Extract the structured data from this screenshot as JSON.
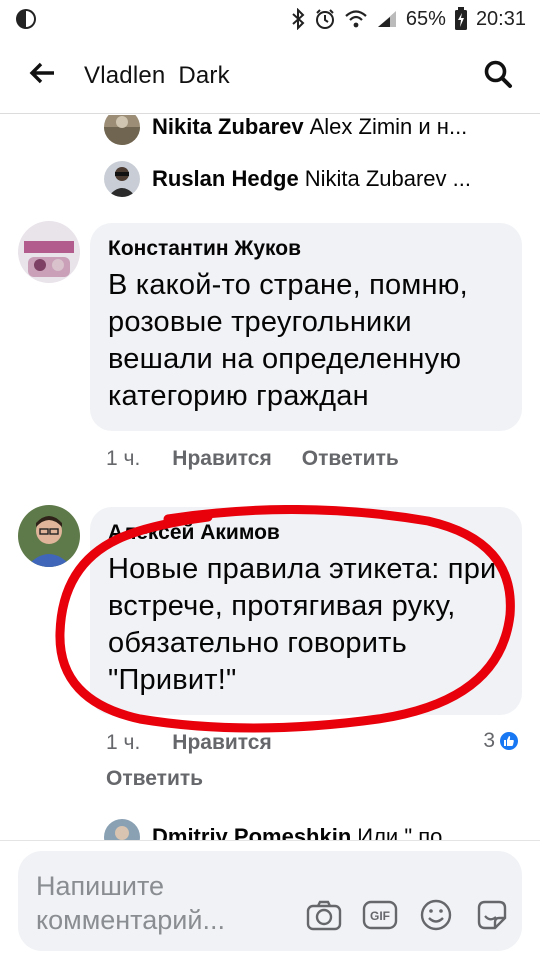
{
  "status_bar": {
    "battery_percent": "65%",
    "time": "20:31"
  },
  "header": {
    "title": "Vladlen  Dark"
  },
  "replies": [
    {
      "author": "Nikita Zubarev",
      "text": "Alex Zimin и н..."
    },
    {
      "author": "Ruslan Hedge",
      "text": "Nikita Zubarev ..."
    }
  ],
  "comments": [
    {
      "author": "Константин Жуков",
      "body": "В какой-то стране, помню, розовые треугольники вешали на определенную категорию граждан",
      "time": "1 ч.",
      "like_label": "Нравится",
      "reply_label": "Ответить"
    },
    {
      "author": "Алексей Акимов",
      "body": "Новые правила этикета: при встрече, протягивая руку, обязательно говорить \"Привит!\"",
      "time": "1 ч.",
      "like_label": "Нравится",
      "reply_label": "Ответить",
      "reaction_count": "3"
    }
  ],
  "next_reply": {
    "author": "Dmitriy Pomeshkin",
    "text": "Или \" по..."
  },
  "composer": {
    "placeholder": "Напишите комментарий..."
  },
  "icons": {
    "app": "messenger-icon",
    "bluetooth": "bluetooth-icon",
    "alarm": "alarm-icon",
    "wifi": "wifi-icon",
    "signal": "signal-icon",
    "battery": "battery-icon",
    "back": "arrow-left-icon",
    "search": "search-icon",
    "like": "thumbs-up-icon",
    "camera": "camera-icon",
    "gif": "gif-icon",
    "emoji": "emoji-icon",
    "sticker": "sticker-icon"
  },
  "colors": {
    "accent": "#1877f2",
    "bubble": "#f0f2f5",
    "meta_text": "#65676b",
    "annotation": "#e8000b"
  }
}
